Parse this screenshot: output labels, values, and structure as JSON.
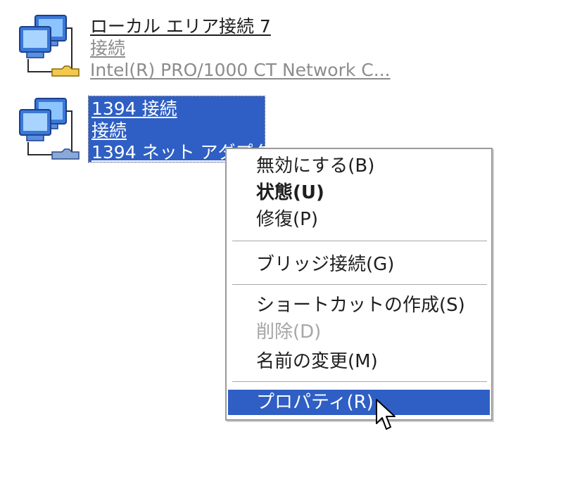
{
  "connections": [
    {
      "name": "ローカル エリア接続 7",
      "status": "接続",
      "device": "Intel(R) PRO/1000 CT Network C...",
      "icon": "network-connection-icon",
      "selected": false
    },
    {
      "name": "1394 接続",
      "status": "接続",
      "device": "1394 ネット アダプタ",
      "icon": "network-connection-icon",
      "selected": true
    }
  ],
  "context_menu": {
    "items": [
      {
        "label": "無効にする(B)",
        "hotkey": "B",
        "bold": false,
        "disabled": false
      },
      {
        "label": "状態(U)",
        "hotkey": "U",
        "bold": true,
        "disabled": false
      },
      {
        "label": "修復(P)",
        "hotkey": "P",
        "bold": false,
        "disabled": false
      },
      {
        "label": "ブリッジ接続(G)",
        "hotkey": "G",
        "bold": false,
        "disabled": false
      },
      {
        "label": "ショートカットの作成(S)",
        "hotkey": "S",
        "bold": false,
        "disabled": false
      },
      {
        "label": "削除(D)",
        "hotkey": "D",
        "bold": false,
        "disabled": true
      },
      {
        "label": "名前の変更(M)",
        "hotkey": "M",
        "bold": false,
        "disabled": false
      },
      {
        "label": "プロパティ(R)",
        "hotkey": "R",
        "bold": false,
        "disabled": false,
        "highlighted": true
      }
    ]
  },
  "colors": {
    "selection": "#2f5fc4",
    "text": "#1e1e1e",
    "subtext": "#8c8c8c",
    "disabled": "#a6a6a6"
  }
}
